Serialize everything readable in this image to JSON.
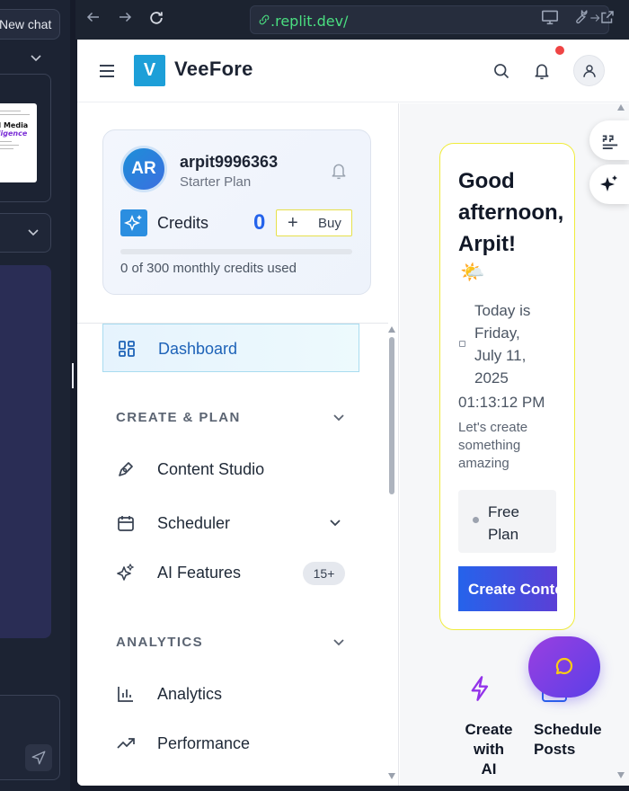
{
  "left_panel": {
    "new_chat_label": "New chat"
  },
  "browser": {
    "url": ".replit.dev/"
  },
  "app": {
    "brand_logo_letter": "V",
    "brand_name": "VeeFore"
  },
  "user_card": {
    "initials": "AR",
    "username": "arpit9996363",
    "plan": "Starter Plan",
    "credits_label": "Credits",
    "credits_value": "0",
    "buy_label": "Buy",
    "credits_used_fraction": 0,
    "usage_text": "0 of 300 monthly credits used"
  },
  "nav": {
    "dashboard": "Dashboard",
    "section_create": "CREATE & PLAN",
    "content_studio": "Content Studio",
    "scheduler": "Scheduler",
    "ai_features": "AI Features",
    "ai_features_badge": "15+",
    "section_analytics": "ANALYTICS",
    "analytics": "Analytics",
    "performance": "Performance"
  },
  "main": {
    "greeting": "Good\nafternoon,\nArpit!",
    "weather_emoji": "🌤️",
    "date": "Today is\nFriday,\nJuly 11,\n2025",
    "time": "01:13:12 PM",
    "subtext": "Let's create something amazing",
    "plan_chip": "Free Plan",
    "create_button": "Create Content",
    "quick_ai_lines": [
      "Create",
      "with",
      "AI"
    ],
    "quick_schedule": "Schedule Posts"
  },
  "icons": {
    "menu": "hamburger-icon",
    "search": "search-icon",
    "bell": "bell-icon",
    "user": "user-icon",
    "dashboard": "grid-icon",
    "content": "pen-icon",
    "scheduler": "calendar-icon",
    "ai": "sparkles-icon",
    "analytics": "bar-chart-icon",
    "performance": "trending-up-icon"
  },
  "colors": {
    "brand": "#1d9fd8",
    "accent": "#2563eb",
    "highlight_border": "#f0ec3c",
    "notification": "#ef4444",
    "fab": "#7c3aed"
  }
}
